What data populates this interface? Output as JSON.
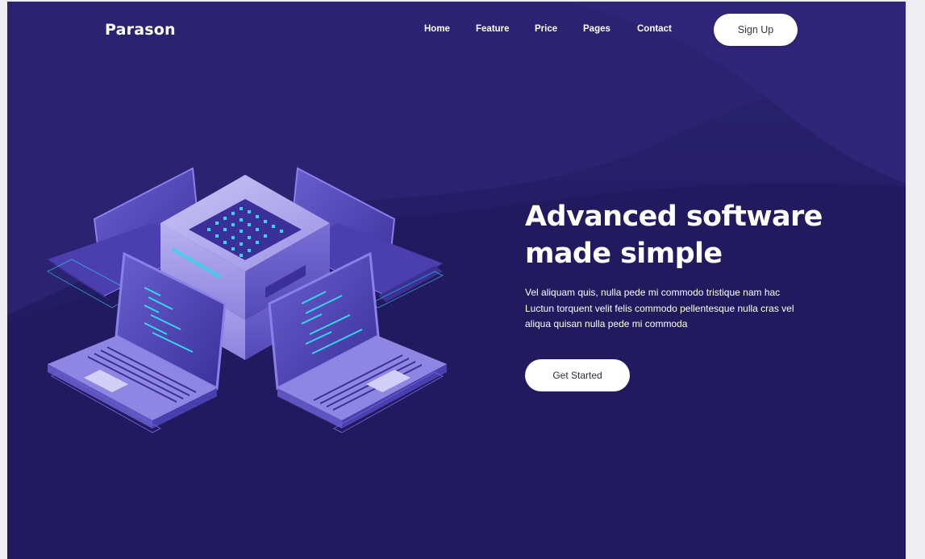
{
  "brand": {
    "logo_text": "Parason"
  },
  "nav": {
    "items": [
      {
        "label": "Home"
      },
      {
        "label": "Feature"
      },
      {
        "label": "Price"
      },
      {
        "label": "Pages"
      },
      {
        "label": "Contact"
      }
    ],
    "signup_label": "Sign Up"
  },
  "hero": {
    "title_line1": "Advanced software",
    "title_line2": "made simple",
    "description": "Vel aliquam quis, nulla pede mi commodo tristique nam hac Luctun torquent velit felis commodo pellentesque nulla cras vel aliqua quisan nulla pede mi commoda",
    "cta_label": "Get Started"
  },
  "illustration": {
    "icon": "server-laptops-isometric-illustration"
  },
  "colors": {
    "background": "#1f1958",
    "wave": "#2a2170",
    "accent_cyan": "#35d6e8",
    "button_bg": "#ffffff"
  }
}
